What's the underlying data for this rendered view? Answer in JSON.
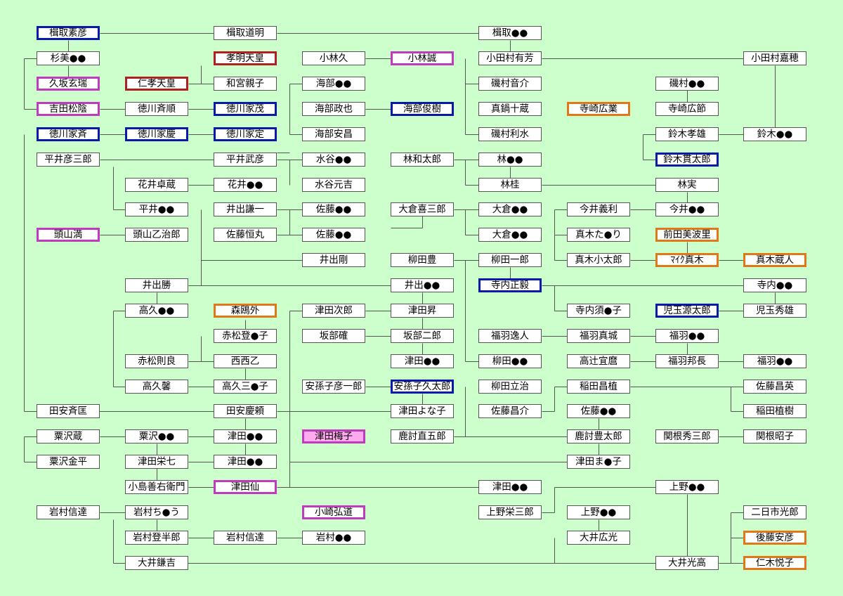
{
  "diagram": {
    "colors": {
      "background": "#ccffcc",
      "box_fill": "#ffffff",
      "box_border": "#555555",
      "line": "#555555",
      "blue_frame": "#0a1aa8",
      "purple_frame": "#c03ac0",
      "red_frame": "#b02020",
      "orange_frame": "#e07818",
      "pink_fill": "#ffaaee"
    },
    "nodes": [
      {
        "id": "n1",
        "label": "楫取素彦",
        "style": "blue"
      },
      {
        "id": "n2",
        "label": "杉美●●"
      },
      {
        "id": "n3",
        "label": "久坂玄瑞",
        "style": "purple"
      },
      {
        "id": "n4",
        "label": "吉田松陰",
        "style": "purple"
      },
      {
        "id": "n5",
        "label": "徳川家斉",
        "style": "blue"
      },
      {
        "id": "n6",
        "label": "平井彦三郎"
      },
      {
        "id": "n7",
        "label": "頭山満",
        "style": "purple"
      },
      {
        "id": "n8",
        "label": "田安斉匡"
      },
      {
        "id": "n9",
        "label": "粟沢蔵"
      },
      {
        "id": "n10",
        "label": "粟沢金平"
      },
      {
        "id": "n11",
        "label": "岩村信達"
      },
      {
        "id": "n12",
        "label": "仁孝天皇",
        "style": "red"
      },
      {
        "id": "n13",
        "label": "徳川斉順"
      },
      {
        "id": "n14",
        "label": "徳川家慶",
        "style": "blue"
      },
      {
        "id": "n15",
        "label": "花井卓蔵"
      },
      {
        "id": "n16",
        "label": "平井●●"
      },
      {
        "id": "n17",
        "label": "頭山乙治郎"
      },
      {
        "id": "n18",
        "label": "井出勝"
      },
      {
        "id": "n19",
        "label": "高久●●"
      },
      {
        "id": "n20",
        "label": "赤松則良"
      },
      {
        "id": "n21",
        "label": "高久馨"
      },
      {
        "id": "n22",
        "label": "粟沢●●"
      },
      {
        "id": "n23",
        "label": "津田栄七"
      },
      {
        "id": "n24",
        "label": "小島善右衛門"
      },
      {
        "id": "n25",
        "label": "岩村ち●う"
      },
      {
        "id": "n26",
        "label": "岩村登半郎"
      },
      {
        "id": "n27",
        "label": "大井鎌吉"
      },
      {
        "id": "n28",
        "label": "楫取道明"
      },
      {
        "id": "n29",
        "label": "孝明天皇",
        "style": "red"
      },
      {
        "id": "n30",
        "label": "和宮親子"
      },
      {
        "id": "n31",
        "label": "徳川家茂",
        "style": "blue"
      },
      {
        "id": "n32",
        "label": "徳川家定",
        "style": "blue"
      },
      {
        "id": "n33",
        "label": "平井武彦"
      },
      {
        "id": "n34",
        "label": "花井●●"
      },
      {
        "id": "n35",
        "label": "井出謙一"
      },
      {
        "id": "n36",
        "label": "佐藤恒丸"
      },
      {
        "id": "n37",
        "label": "森鴎外",
        "style": "orange"
      },
      {
        "id": "n38",
        "label": "赤松登●子"
      },
      {
        "id": "n39",
        "label": "西西乙"
      },
      {
        "id": "n40",
        "label": "高久三●子"
      },
      {
        "id": "n41",
        "label": "田安慶頼"
      },
      {
        "id": "n42",
        "label": "津田●●"
      },
      {
        "id": "n43",
        "label": "津田●●"
      },
      {
        "id": "n44",
        "label": "津田仙",
        "style": "purple"
      },
      {
        "id": "n45",
        "label": "岩村信達"
      },
      {
        "id": "n46",
        "label": "小林久"
      },
      {
        "id": "n47",
        "label": "海部●●"
      },
      {
        "id": "n48",
        "label": "海部政也"
      },
      {
        "id": "n49",
        "label": "海部安昌"
      },
      {
        "id": "n50",
        "label": "水谷●●"
      },
      {
        "id": "n51",
        "label": "水谷元吉"
      },
      {
        "id": "n52",
        "label": "佐藤●●"
      },
      {
        "id": "n53",
        "label": "佐藤●●"
      },
      {
        "id": "n54",
        "label": "井出剛"
      },
      {
        "id": "n55",
        "label": "津田次郎"
      },
      {
        "id": "n56",
        "label": "坂部確"
      },
      {
        "id": "n57",
        "label": "安孫子彦一郎"
      },
      {
        "id": "n58",
        "label": "津田梅子",
        "style": "purple-pink"
      },
      {
        "id": "n59",
        "label": "小崎弘道",
        "style": "purple"
      },
      {
        "id": "n60",
        "label": "岩村●●"
      },
      {
        "id": "n61",
        "label": "小林誠",
        "style": "purple"
      },
      {
        "id": "n62",
        "label": "海部俊樹",
        "style": "blue"
      },
      {
        "id": "n63",
        "label": "林和太郎"
      },
      {
        "id": "n64",
        "label": "大倉喜三郎"
      },
      {
        "id": "n65",
        "label": "柳田豊"
      },
      {
        "id": "n66",
        "label": "井出●●"
      },
      {
        "id": "n67",
        "label": "津田昇"
      },
      {
        "id": "n68",
        "label": "坂部二郎"
      },
      {
        "id": "n69",
        "label": "津田●●"
      },
      {
        "id": "n70",
        "label": "安孫子久太郎",
        "style": "blue"
      },
      {
        "id": "n71",
        "label": "津田よな子"
      },
      {
        "id": "n72",
        "label": "鹿討直五郎"
      },
      {
        "id": "n73",
        "label": "楫取●●"
      },
      {
        "id": "n74",
        "label": "小田村有芳"
      },
      {
        "id": "n75",
        "label": "磯村音介"
      },
      {
        "id": "n76",
        "label": "真鍋十蔵"
      },
      {
        "id": "n77",
        "label": "磯村利水"
      },
      {
        "id": "n78",
        "label": "林●●"
      },
      {
        "id": "n79",
        "label": "林桂"
      },
      {
        "id": "n80",
        "label": "大倉●●"
      },
      {
        "id": "n81",
        "label": "大倉●●"
      },
      {
        "id": "n82",
        "label": "柳田一郎"
      },
      {
        "id": "n83",
        "label": "寺内正毅",
        "style": "blue"
      },
      {
        "id": "n84",
        "label": "福羽逸人"
      },
      {
        "id": "n85",
        "label": "柳田●●"
      },
      {
        "id": "n86",
        "label": "柳田立治"
      },
      {
        "id": "n87",
        "label": "佐藤昌介"
      },
      {
        "id": "n88",
        "label": "津田●●"
      },
      {
        "id": "n89",
        "label": "上野栄三郎"
      },
      {
        "id": "n90",
        "label": "寺崎広業",
        "style": "orange"
      },
      {
        "id": "n91",
        "label": "今井義利"
      },
      {
        "id": "n92",
        "label": "真木た●り"
      },
      {
        "id": "n93",
        "label": "真木小太郎"
      },
      {
        "id": "n94",
        "label": "寺内須●子"
      },
      {
        "id": "n95",
        "label": "福羽真城"
      },
      {
        "id": "n96",
        "label": "高辻宜麿"
      },
      {
        "id": "n97",
        "label": "稲田昌植"
      },
      {
        "id": "n98",
        "label": "佐藤●●"
      },
      {
        "id": "n99",
        "label": "鹿討豊太郎"
      },
      {
        "id": "n100",
        "label": "津田ま●子"
      },
      {
        "id": "n101",
        "label": "上野●●"
      },
      {
        "id": "n102",
        "label": "大井広光"
      },
      {
        "id": "n103",
        "label": "磯村●●"
      },
      {
        "id": "n104",
        "label": "寺崎広節"
      },
      {
        "id": "n105",
        "label": "鈴木孝雄"
      },
      {
        "id": "n106",
        "label": "鈴木貫太郎",
        "style": "blue"
      },
      {
        "id": "n107",
        "label": "林実"
      },
      {
        "id": "n108",
        "label": "今井●●"
      },
      {
        "id": "n109",
        "label": "前田美波里",
        "style": "orange"
      },
      {
        "id": "n110",
        "label": "ﾏｲｸ真木",
        "style": "orange"
      },
      {
        "id": "n111",
        "label": "児玉源太郎",
        "style": "blue"
      },
      {
        "id": "n112",
        "label": "福羽●●"
      },
      {
        "id": "n113",
        "label": "福羽邦長"
      },
      {
        "id": "n114",
        "label": "関根秀三郎"
      },
      {
        "id": "n115",
        "label": "上野●●"
      },
      {
        "id": "n116",
        "label": "大井光高"
      },
      {
        "id": "n117",
        "label": "小田村嘉穂"
      },
      {
        "id": "n118",
        "label": "鈴木●●"
      },
      {
        "id": "n119",
        "label": "真木蔵人",
        "style": "orange"
      },
      {
        "id": "n120",
        "label": "寺内●●"
      },
      {
        "id": "n121",
        "label": "児玉秀雄"
      },
      {
        "id": "n122",
        "label": "福羽●●"
      },
      {
        "id": "n123",
        "label": "佐藤昌英"
      },
      {
        "id": "n124",
        "label": "稲田植樹"
      },
      {
        "id": "n125",
        "label": "関根昭子"
      },
      {
        "id": "n126",
        "label": "二日市光郎"
      },
      {
        "id": "n127",
        "label": "後藤安彦",
        "style": "orange"
      },
      {
        "id": "n128",
        "label": "仁木悦子",
        "style": "orange"
      }
    ]
  }
}
